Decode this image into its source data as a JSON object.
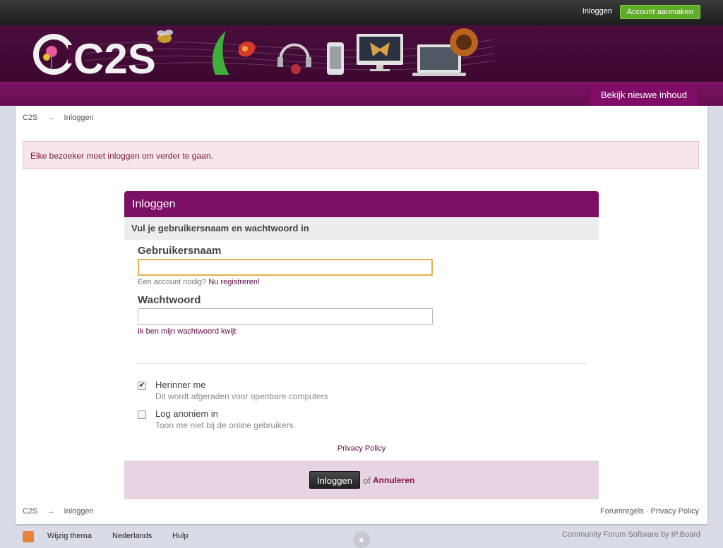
{
  "userbar": {
    "signin_label": "Inloggen",
    "create_account_label": "Account aanmaken"
  },
  "branding": {
    "logo_text": "C2S"
  },
  "primary_nav": {
    "tab_label": "Bekijk nieuwe inhoud"
  },
  "breadcrumb": {
    "home": "C2S",
    "separator": "→",
    "current": "Inloggen"
  },
  "message": "Elke bezoeker moet inloggen om verder te gaan.",
  "login": {
    "title": "Inloggen",
    "subtitle": "Vul je gebruikersnaam en wachtwoord in",
    "username_label": "Gebruikersnaam",
    "username_value": "",
    "register_hint": "Een account nodig?",
    "register_link": "Nu registreren!",
    "password_label": "Wachtwoord",
    "password_value": "",
    "forgot_link": "Ik ben mijn wachtwoord kwijt",
    "remember_label": "Herinner me",
    "remember_desc": "Dit wordt afgeraden voor openbare computers",
    "remember_checked": true,
    "anon_label": "Log anoniem in",
    "anon_desc": "Toon me niet bij de online gebruikers",
    "anon_checked": false,
    "privacy_link": "Privacy Policy",
    "submit_label": "Inloggen",
    "or_text": "of",
    "cancel_label": "Annuleren"
  },
  "footer_links": {
    "rules": "Forumregels",
    "dot": "·",
    "privacy": "Privacy Policy"
  },
  "footer": {
    "theme_label": "Wijzig thema",
    "language_label": "Nederlands",
    "help_label": "Hulp",
    "copyright": "Community Forum Software by IP.Board"
  },
  "colors": {
    "brand_purple": "#7b0f63",
    "create_green": "#5fab2a",
    "alert_pink": "#f6e6ec"
  },
  "icons": {
    "rss": "rss-icon",
    "to_top": "arrow-up-icon"
  }
}
